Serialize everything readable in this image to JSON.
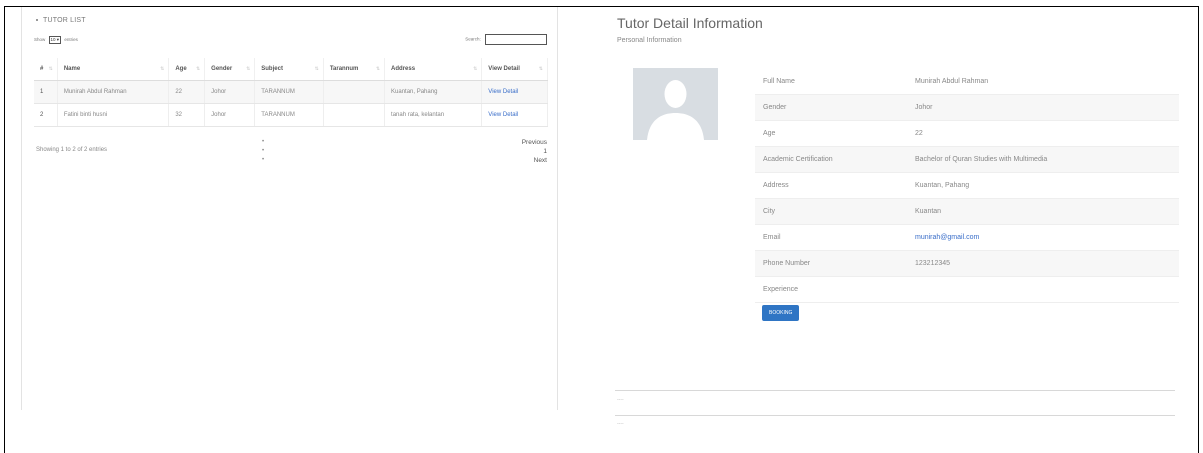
{
  "tutor_list": {
    "title": "TUTOR LIST",
    "show_label": "Show",
    "show_value": "10",
    "entries_label": "entries",
    "search_label": "Search:",
    "columns": [
      "#",
      "Name",
      "Age",
      "Gender",
      "Subject",
      "Tarannum",
      "Address",
      "View Detail"
    ],
    "rows": [
      {
        "num": "1",
        "name": "Munirah Abdul Rahman",
        "age": "22",
        "gender": "Johor",
        "subject": "TARANNUM",
        "tarannum": "",
        "address": "Kuantan, Pahang",
        "view": "View Detail"
      },
      {
        "num": "2",
        "name": "Fatini binti husni",
        "age": "32",
        "gender": "Johor",
        "subject": "TARANNUM",
        "tarannum": "",
        "address": "tanah rata, kelantan",
        "view": "View Detail"
      }
    ],
    "showing": "Showing 1 to 2 of 2 entries",
    "pager": {
      "previous": "Previous",
      "page": "1",
      "next": "Next"
    }
  },
  "detail": {
    "title": "Tutor Detail Information",
    "subtitle": "Personal Information",
    "fields": [
      {
        "label": "Full Name",
        "value": "Munirah Abdul Rahman"
      },
      {
        "label": "Gender",
        "value": "Johor"
      },
      {
        "label": "Age",
        "value": "22"
      },
      {
        "label": "Academic Certification",
        "value": "Bachelor of Quran Studies with Multimedia"
      },
      {
        "label": "Address",
        "value": "Kuantan, Pahang"
      },
      {
        "label": "City",
        "value": "Kuantan"
      },
      {
        "label": "Email",
        "value": "munirah@gmail.com"
      },
      {
        "label": "Phone Number",
        "value": "123212345"
      },
      {
        "label": "Experience",
        "value": ""
      }
    ],
    "booking_label": "BOOKING",
    "footer_marks": [
      "----",
      "----"
    ]
  },
  "colors": {
    "link": "#3a6ec9",
    "button": "#2f75c4"
  }
}
